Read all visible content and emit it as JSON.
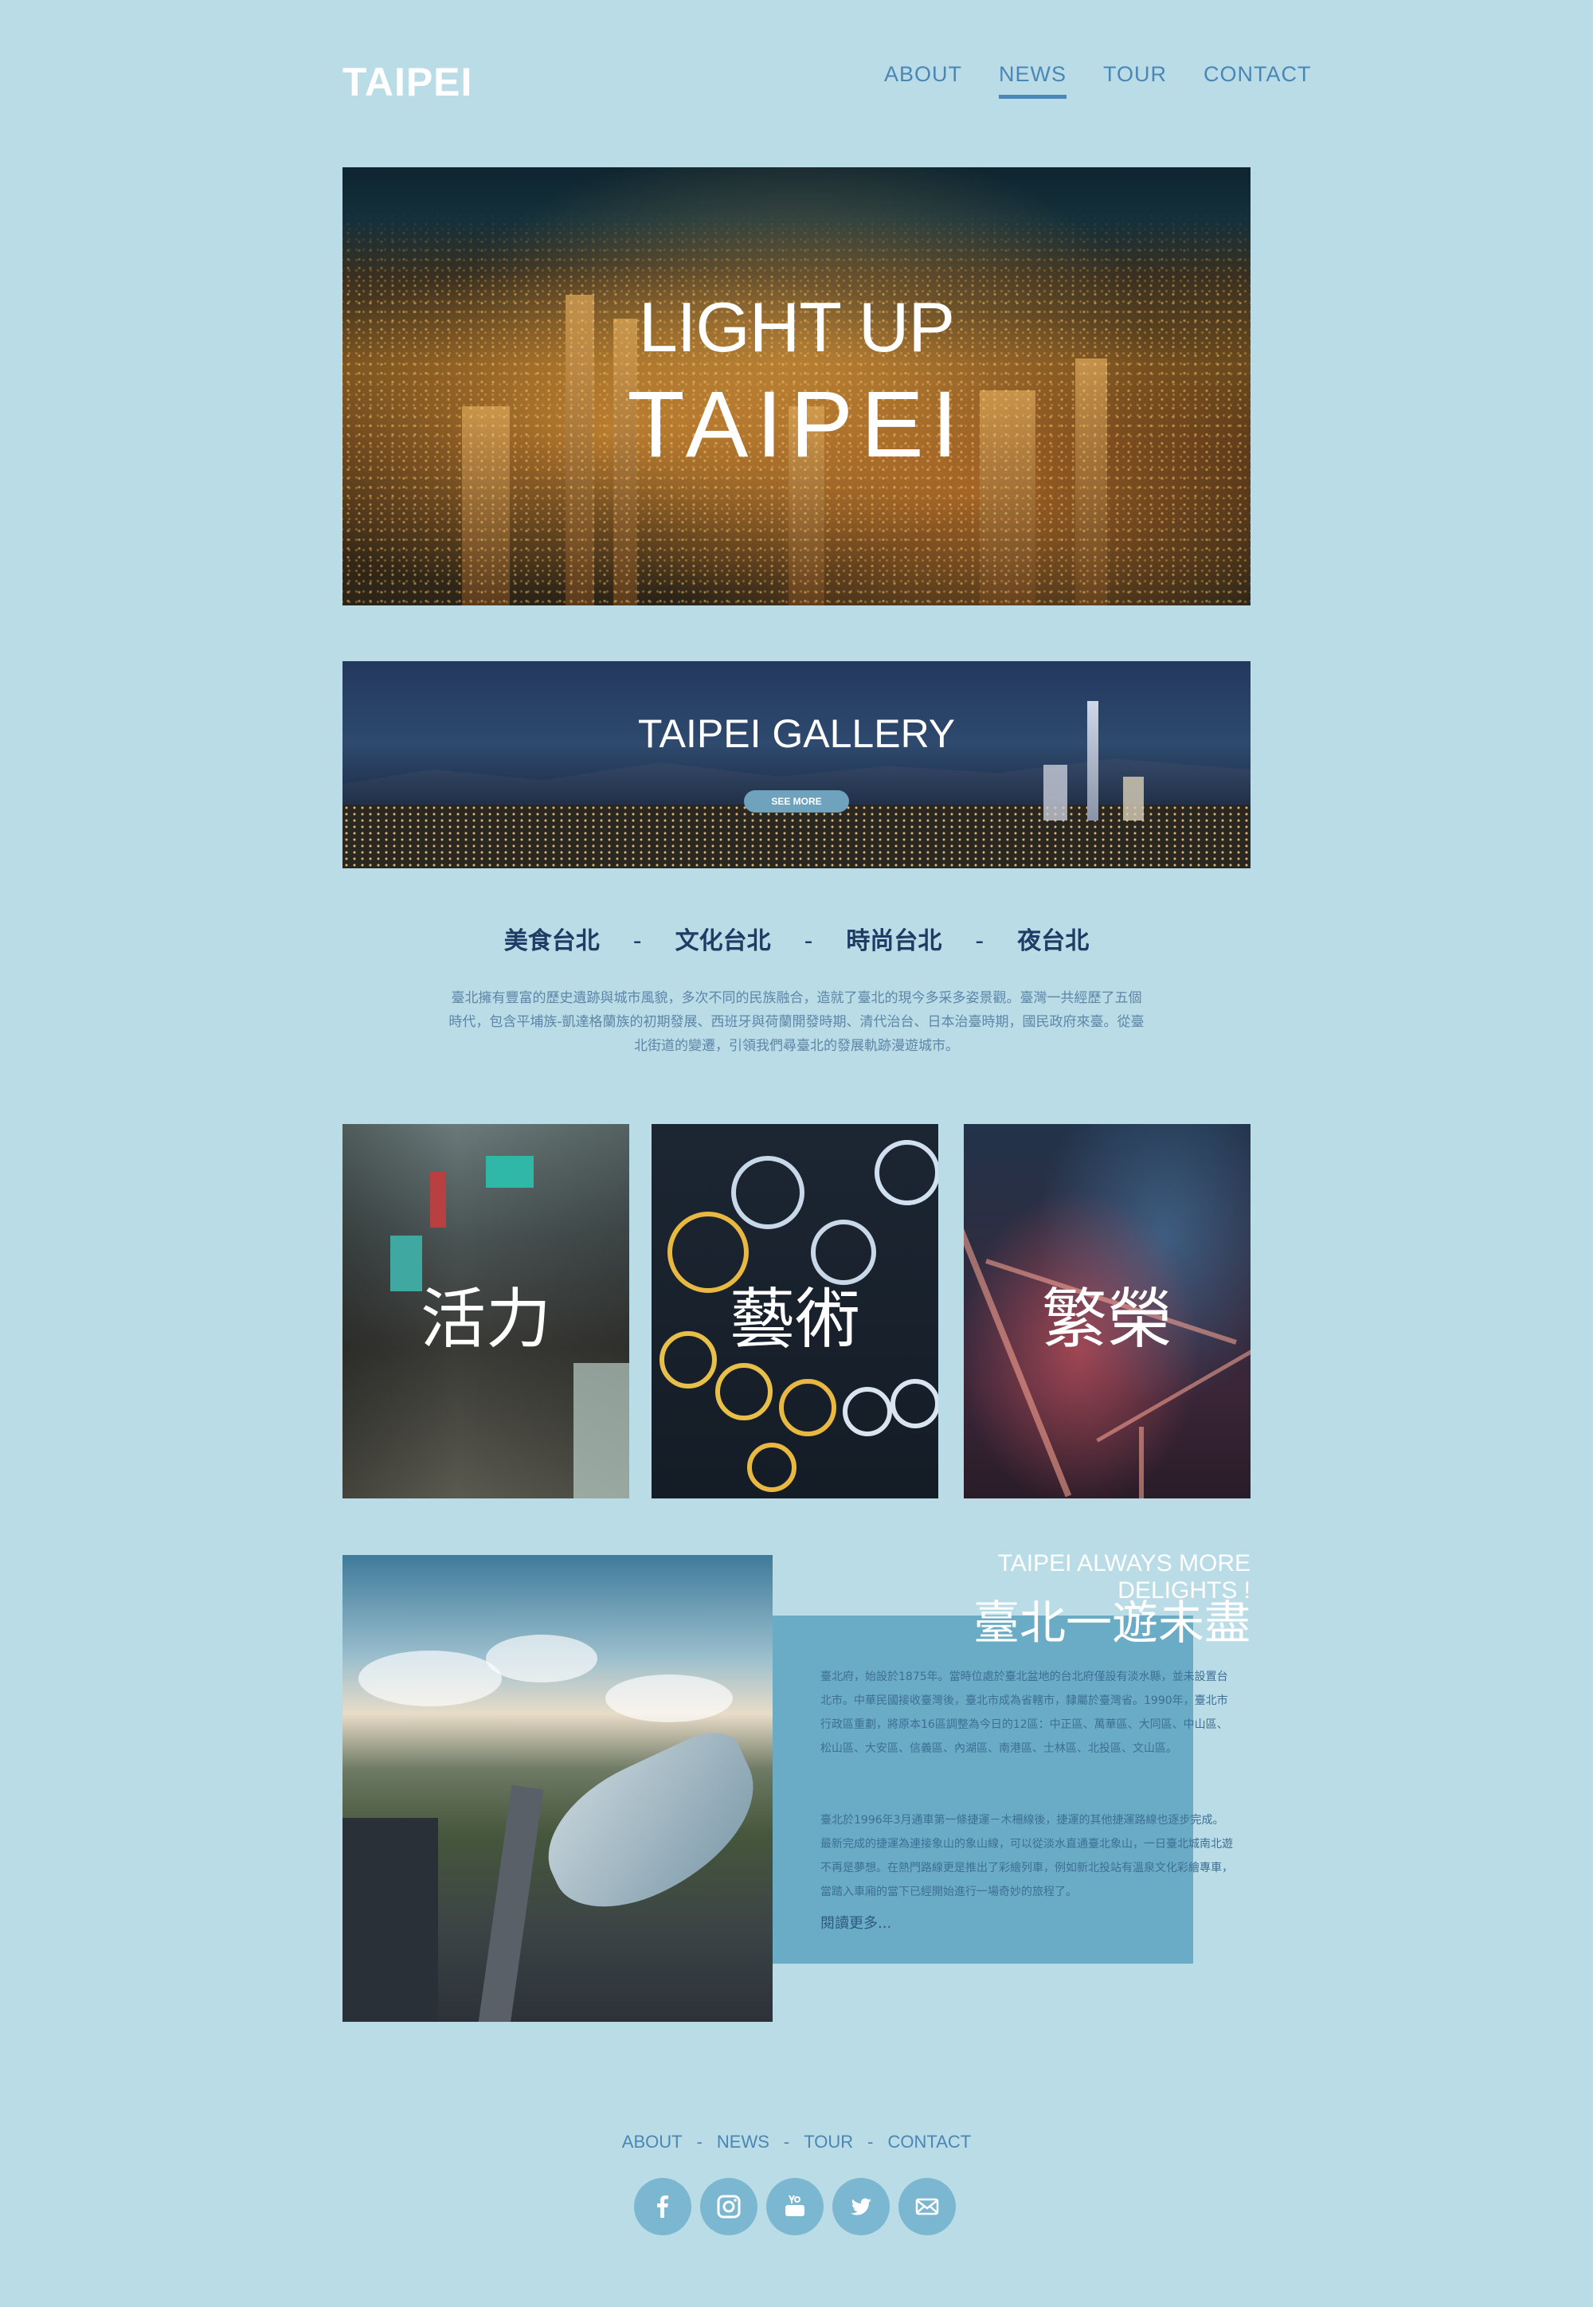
{
  "header": {
    "logo": "TAIPEI",
    "nav": [
      "ABOUT",
      "NEWS",
      "TOUR",
      "CONTACT"
    ],
    "active_nav": "NEWS"
  },
  "hero": {
    "line1": "LIGHT UP",
    "line2": "TAIPEI"
  },
  "gallery": {
    "title": "TAIPEI GALLERY",
    "button": "SEE MORE"
  },
  "categories": [
    "美食台北",
    "文化台北",
    "時尚台北",
    "夜台北"
  ],
  "category_separator": "-",
  "intro": "臺北擁有豐富的歷史遺跡與城市風貌，多次不同的民族融合，造就了臺北的現今多采多姿景觀。臺灣一共經歷了五個時代，包含平埔族-凱達格蘭族的初期發展、西班牙與荷蘭開發時期、清代治台、日本治臺時期，國民政府來臺。從臺北街道的變遷，引領我們尋臺北的發展軌跡漫遊城市。",
  "tiles": [
    {
      "label": "活力"
    },
    {
      "label": "藝術"
    },
    {
      "label": "繁榮"
    }
  ],
  "feature": {
    "title_en": "TAIPEI ALWAYS MORE DELIGHTS !",
    "title_zh": "臺北一遊未盡",
    "paragraph1": "臺北府，始設於1875年。當時位處於臺北盆地的台北府僅設有淡水縣，並未設置台北市。中華民國接收臺灣後，臺北市成為省轄市，隸屬於臺灣省。1990年，臺北市行政區重劃，將原本16區調整為今日的12區：中正區、萬華區、大同區、中山區、松山區、大安區、信義區、內湖區、南港區、士林區、北投區、文山區。",
    "paragraph2": "臺北於1996年3月通車第一條捷運－木柵線後，捷運的其他捷運路線也逐步完成。最新完成的捷運為連接象山的象山線，可以從淡水直通臺北象山，一日臺北城南北遊不再是夢想。在熱門路線更是推出了彩繪列車，例如新北投站有溫泉文化彩繪專車，當踏入車廂的當下已經開始進行一場奇妙的旅程了。",
    "read_more": "閱讀更多..."
  },
  "footer": {
    "nav": [
      "ABOUT",
      "NEWS",
      "TOUR",
      "CONTACT"
    ],
    "separator": "-",
    "socials": [
      "facebook-icon",
      "instagram-icon",
      "youtube-icon",
      "twitter-icon",
      "mail-icon"
    ]
  },
  "colors": {
    "background": "#b9dce6",
    "accent": "#4a86b6",
    "box": "#6aabc6",
    "social": "#7bb7d0"
  }
}
